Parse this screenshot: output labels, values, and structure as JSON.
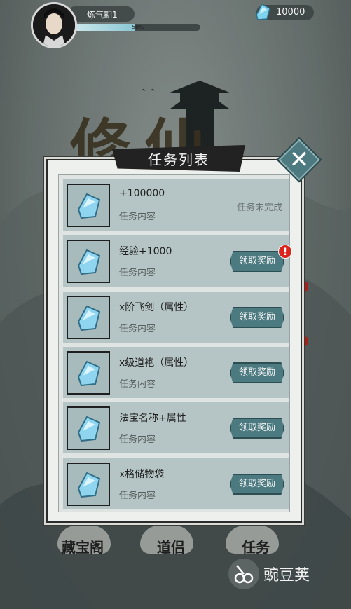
{
  "player": {
    "realm": "炼气期1",
    "exp_text": "50%",
    "exp_fraction": 0.5,
    "currency_icon": "blue-crystal-icon",
    "currency_value": "10000"
  },
  "dialog": {
    "title": "任务列表",
    "close_icon": "close-icon",
    "tasks": [
      {
        "name": "+100000",
        "desc": "任务内容",
        "status": "任务未完成"
      },
      {
        "name": "经验+1000",
        "desc": "任务内容",
        "button": "领取奖励",
        "alert": "!"
      },
      {
        "name": "x阶飞剑（属性）",
        "desc": "任务内容",
        "button": "领取奖励"
      },
      {
        "name": "x级道袍（属性）",
        "desc": "任务内容",
        "button": "领取奖励"
      },
      {
        "name": "法宝名称+属性",
        "desc": "任务内容",
        "button": "领取奖励"
      },
      {
        "name": "x格储物袋",
        "desc": "任务内容",
        "button": "领取奖励"
      }
    ]
  },
  "bottom_nav": {
    "item1": "藏宝阁",
    "item2": "道侣",
    "item3": "任务"
  },
  "watermark": "豌豆荚",
  "colors": {
    "accent": "#4c7a81",
    "alert": "#d8261f",
    "dialog_bg": "#eef0ed"
  }
}
